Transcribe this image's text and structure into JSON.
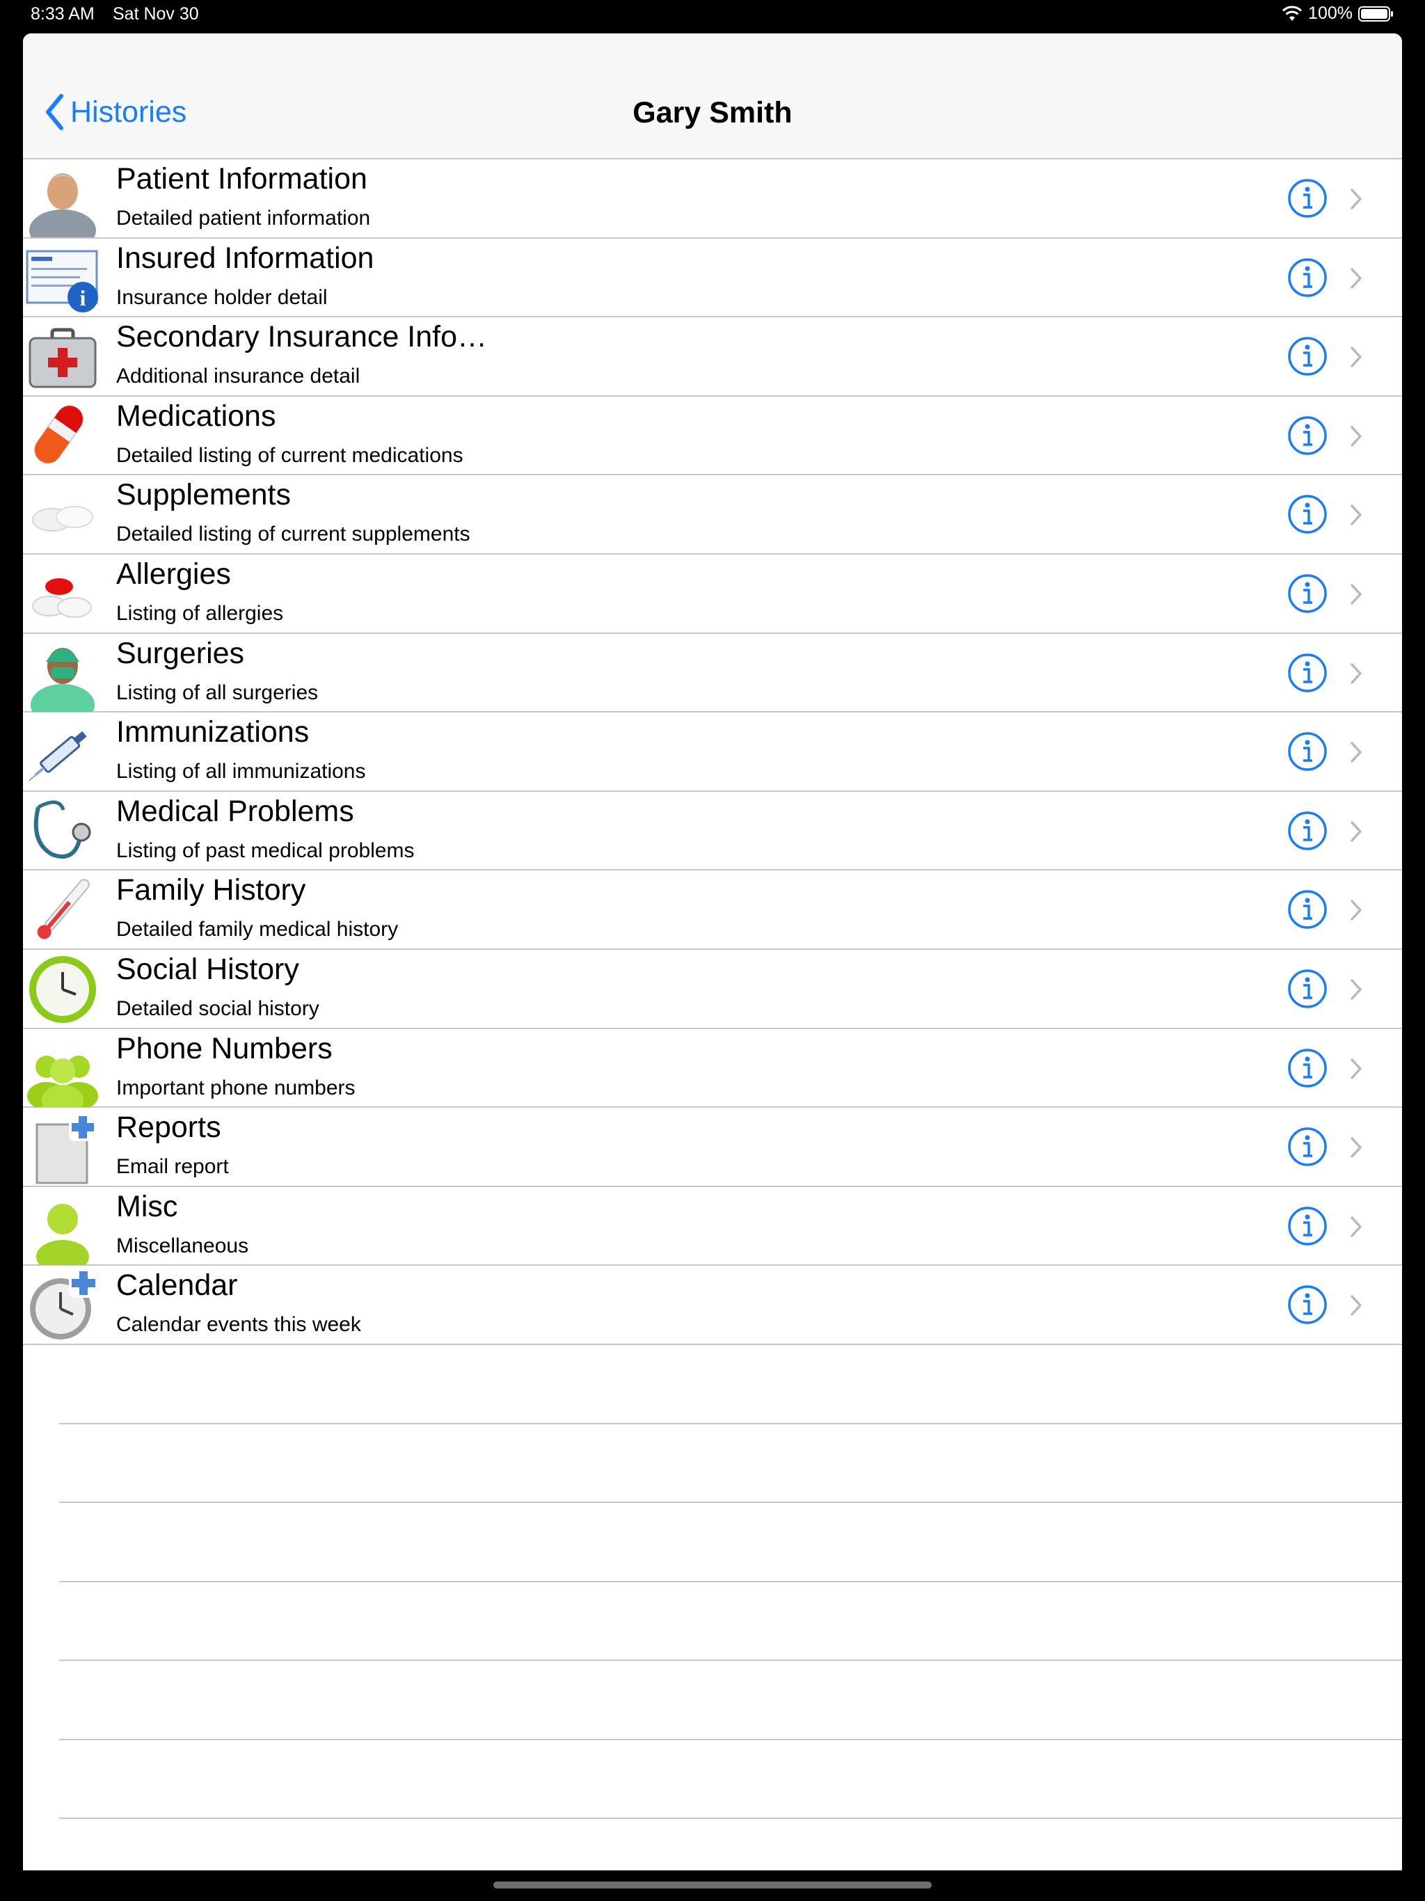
{
  "status_bar": {
    "time": "8:33 AM",
    "date": "Sat Nov 30",
    "battery": "100%",
    "icons": [
      "wifi-icon",
      "battery-icon"
    ]
  },
  "nav": {
    "back_label": "Histories",
    "title": "Gary Smith",
    "accent_color": "#1a7cf6"
  },
  "rows": [
    {
      "title": "Patient Information",
      "subtitle": "Detailed patient information",
      "icon": "patient-icon"
    },
    {
      "title": "Insured Information",
      "subtitle": "Insurance holder detail",
      "icon": "insurance-card-icon"
    },
    {
      "title": "Secondary Insurance Info…",
      "subtitle": "Additional insurance detail",
      "icon": "first-aid-kit-icon"
    },
    {
      "title": "Medications",
      "subtitle": "Detailed listing of current medications",
      "icon": "capsules-icon"
    },
    {
      "title": "Supplements",
      "subtitle": "Detailed listing of current supplements",
      "icon": "tablets-icon"
    },
    {
      "title": "Allergies",
      "subtitle": "Listing of allergies",
      "icon": "pills-icon"
    },
    {
      "title": "Surgeries",
      "subtitle": "Listing of all surgeries",
      "icon": "surgeon-icon"
    },
    {
      "title": "Immunizations",
      "subtitle": "Listing of all immunizations",
      "icon": "syringe-icon"
    },
    {
      "title": "Medical Problems",
      "subtitle": "Listing of past medical problems",
      "icon": "stethoscope-icon"
    },
    {
      "title": "Family History",
      "subtitle": "Detailed family medical history",
      "icon": "thermometer-icon"
    },
    {
      "title": "Social History",
      "subtitle": "Detailed social history",
      "icon": "clock-icon"
    },
    {
      "title": "Phone Numbers",
      "subtitle": "Important phone numbers",
      "icon": "contacts-icon"
    },
    {
      "title": "Reports",
      "subtitle": "Email report",
      "icon": "add-document-icon"
    },
    {
      "title": "Misc",
      "subtitle": "Miscellaneous",
      "icon": "person-icon"
    },
    {
      "title": "Calendar",
      "subtitle": "Calendar events this week",
      "icon": "add-clock-icon"
    }
  ]
}
